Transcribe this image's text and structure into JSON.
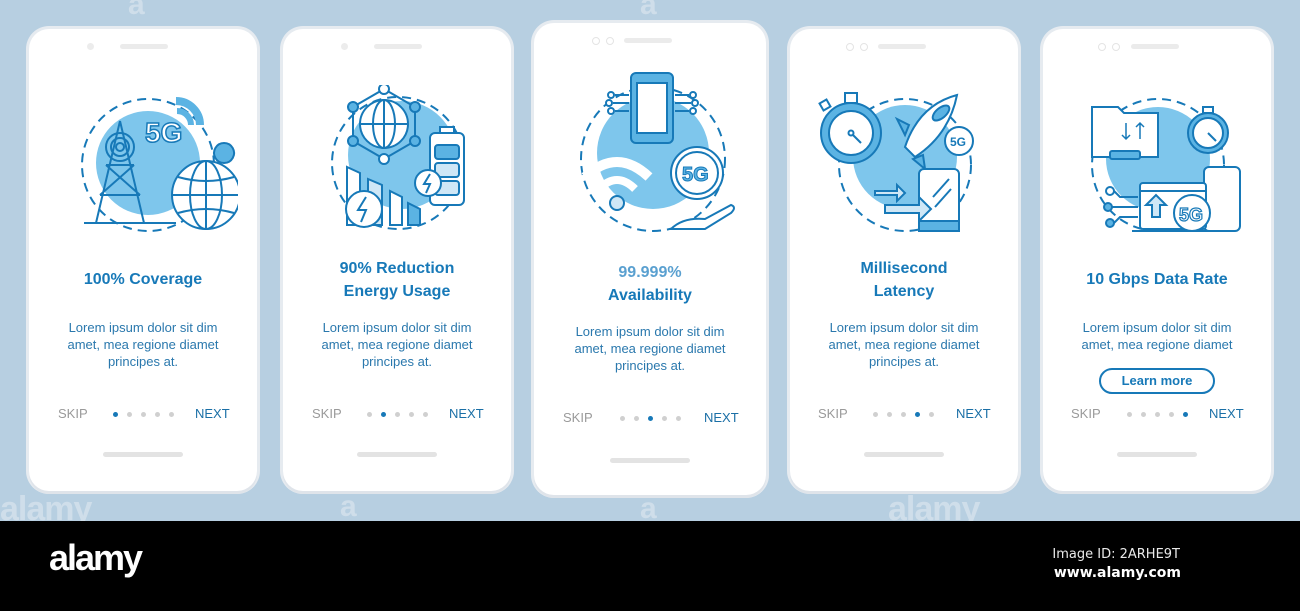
{
  "screens": [
    {
      "title_lines": [
        "100% Coverage"
      ],
      "body": "Lorem ipsum dolor sit dim amet, mea regione diamet principes at.",
      "skip": "SKIP",
      "next": "NEXT",
      "active_dot": 0,
      "illustration": "5g-tower-globe-icon"
    },
    {
      "title_lines": [
        "90% Reduction",
        "Energy Usage"
      ],
      "body": "Lorem ipsum dolor sit dim amet, mea regione diamet principes at.",
      "skip": "SKIP",
      "next": "NEXT",
      "active_dot": 1,
      "illustration": "energy-battery-globe-icon"
    },
    {
      "title_lines": [
        "99.999%",
        "Availability"
      ],
      "body": "Lorem ipsum dolor sit dim amet, mea regione diamet principes at.",
      "skip": "SKIP",
      "next": "NEXT",
      "active_dot": 2,
      "illustration": "smartphone-wifi-5g-hand-icon"
    },
    {
      "title_lines": [
        "Millisecond",
        "Latency"
      ],
      "body": "Lorem ipsum dolor sit dim amet, mea regione diamet principes at.",
      "skip": "SKIP",
      "next": "NEXT",
      "active_dot": 3,
      "illustration": "stopwatch-rocket-phone-icon"
    },
    {
      "title_lines": [
        "10 Gbps Data Rate"
      ],
      "body": "Lorem ipsum dolor sit dim amet, mea regione diamet",
      "skip": "SKIP",
      "next": "NEXT",
      "active_dot": 4,
      "learn_more": "Learn more",
      "illustration": "folder-stopwatch-laptop-5g-icon"
    }
  ],
  "dot_count": 5,
  "icon_text": {
    "five_g": "5G"
  },
  "watermark": {
    "word": "alamy",
    "letter": "a"
  },
  "banner": {
    "logo": "alamy",
    "image_id": "Image ID: 2ARHE9T",
    "site": "www.alamy.com"
  },
  "colors": {
    "accent": "#1779b8",
    "light_blue": "#7ec6ec",
    "background": "#b7cfe1"
  }
}
